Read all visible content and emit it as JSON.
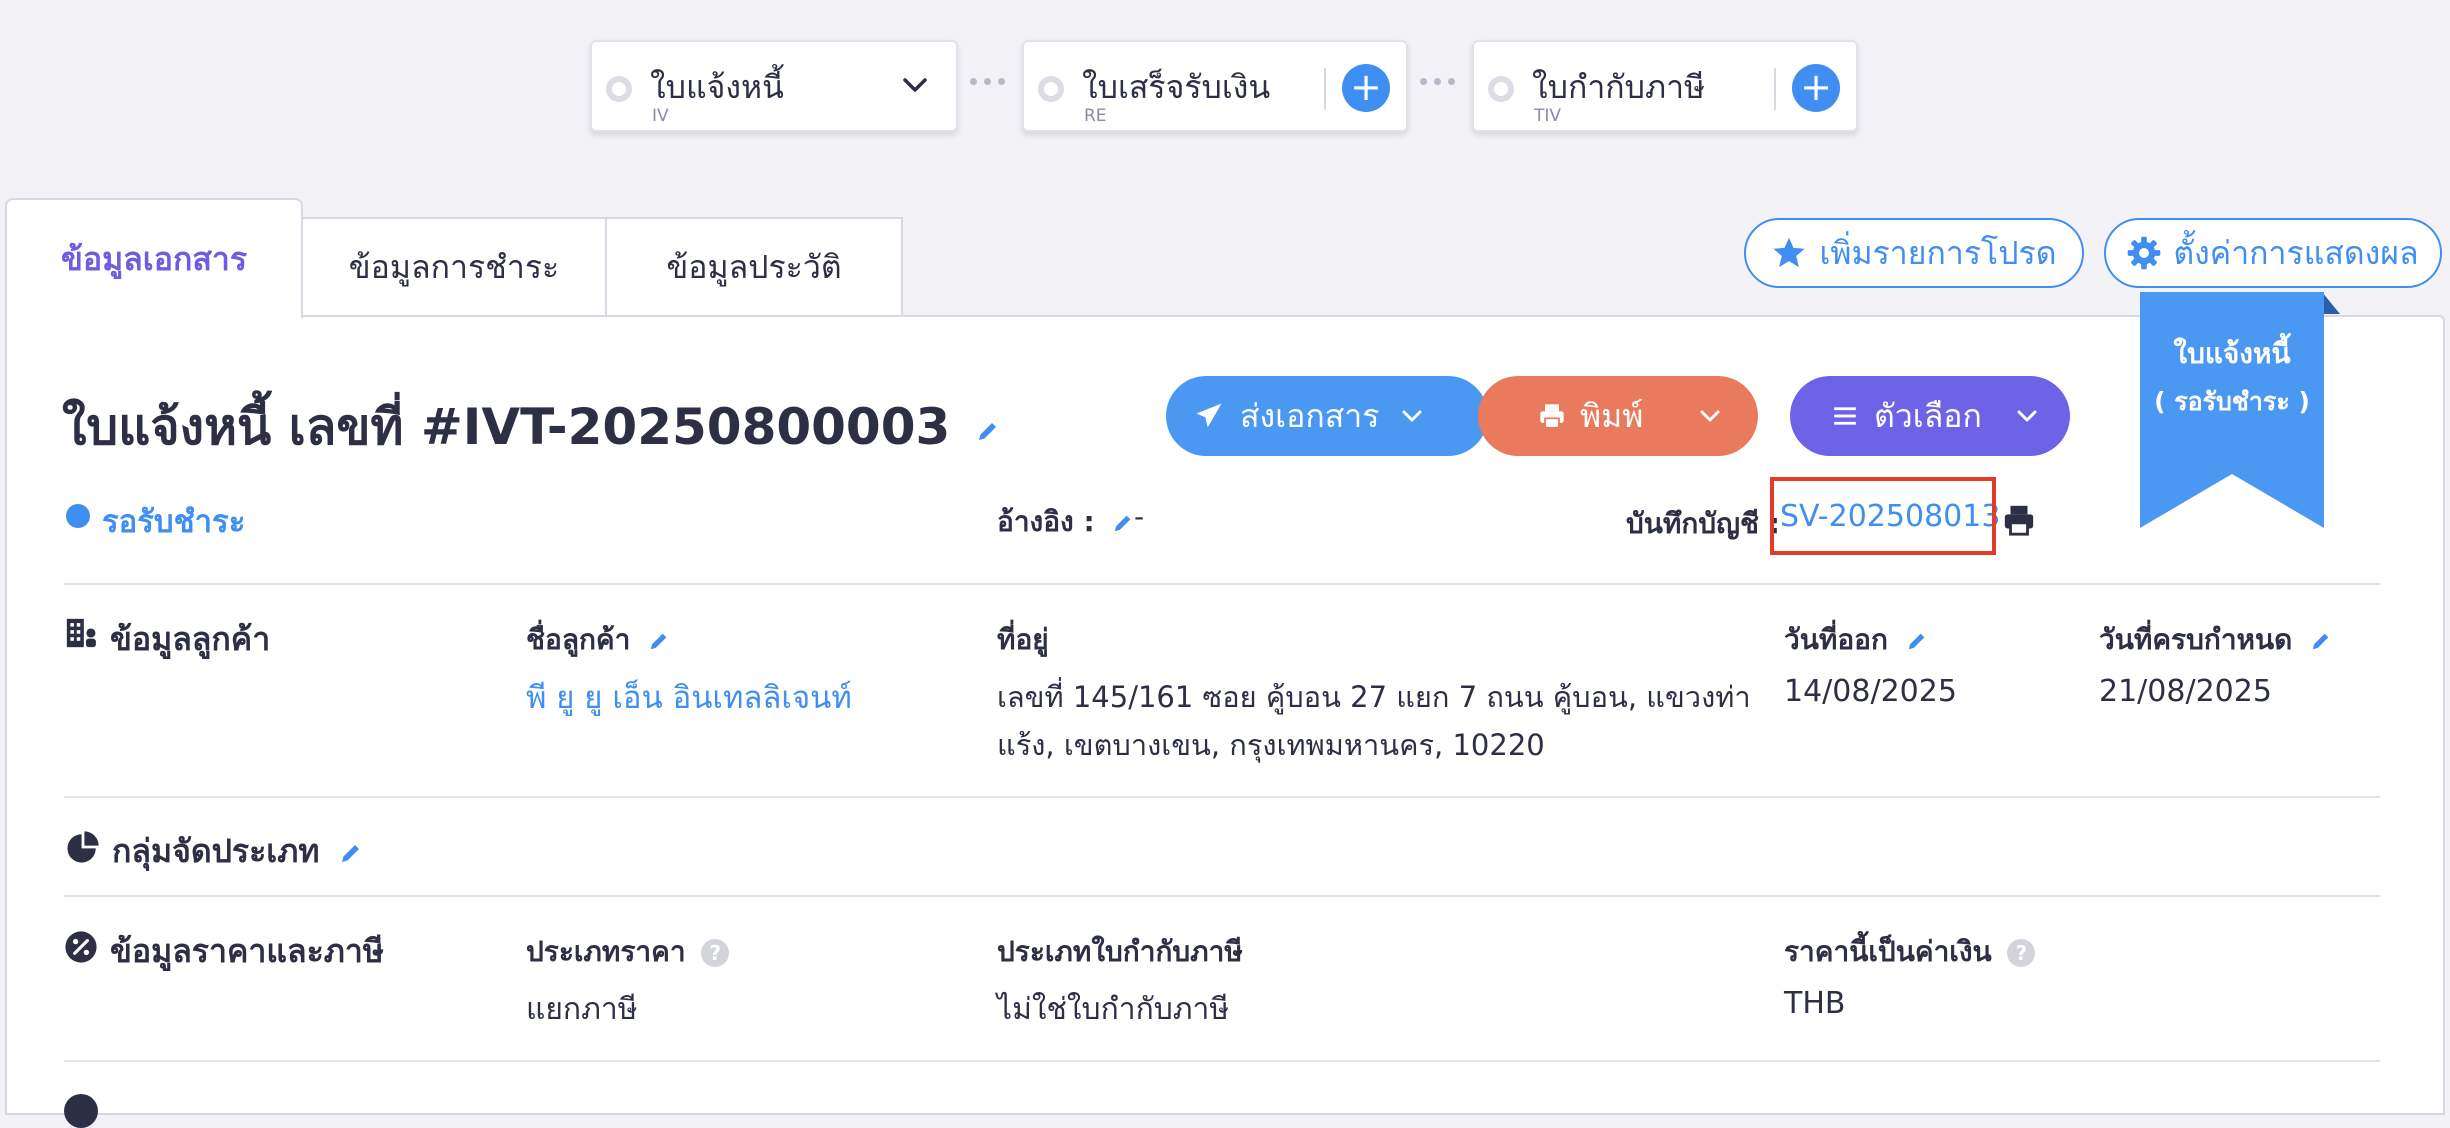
{
  "flow": [
    {
      "title": "ใบแจ้งหนี้",
      "code": "IV"
    },
    {
      "title": "ใบเสร็จรับเงิน",
      "code": "RE"
    },
    {
      "title": "ใบกำกับภาษี",
      "code": "TIV"
    }
  ],
  "tabs": {
    "document": "ข้อมูลเอกสาร",
    "payment": "ข้อมูลการชำระ",
    "history": "ข้อมูลประวัติ"
  },
  "actions": {
    "favorite": "เพิ่มรายการโปรด",
    "display_settings": "ตั้งค่าการแสดงผล",
    "send": "ส่งเอกสาร",
    "print": "พิมพ์",
    "options": "ตัวเลือก"
  },
  "ribbon": {
    "line1": "ใบแจ้งหนี้",
    "line2": "( รอรับชำระ )"
  },
  "document": {
    "title": "ใบแจ้งหนี้ เลขที่ #IVT-20250800003",
    "status": "รอรับชำระ",
    "reference_label": "อ้างอิง :",
    "reference_value": "-",
    "ledger_label": "บันทึกบัญชี :",
    "ledger_value": "SV-202508013"
  },
  "customer": {
    "section_title": "ข้อมูลลูกค้า",
    "name_label": "ชื่อลูกค้า",
    "name_value": "พี ยู ยู เอ็น อินเทลลิเจนท์",
    "address_label": "ที่อยู่",
    "address_line1": "เลขที่ 145/161 ซอย คู้บอน 27 แยก 7 ถนน คู้บอน, แขวงท่า",
    "address_line2": "แร้ง, เขตบางเขน, กรุงเทพมหานคร, 10220",
    "issue_label": "วันที่ออก",
    "issue_value": "14/08/2025",
    "due_label": "วันที่ครบกำหนด",
    "due_value": "21/08/2025"
  },
  "category": {
    "section_title": "กลุ่มจัดประเภท"
  },
  "pricing": {
    "section_title": "ข้อมูลราคาและภาษี",
    "price_type_label": "ประเภทราคา",
    "price_type_value": "แยกภาษี",
    "tax_invoice_type_label": "ประเภทใบกำกับภาษี",
    "tax_invoice_type_value": "ไม่ใช่ใบกำกับภาษี",
    "currency_label": "ราคานี้เป็นค่าเงิน",
    "currency_value": "THB"
  },
  "colors": {
    "accent_blue": "#3f8ef2",
    "accent_orange": "#ea7a5e",
    "accent_purple": "#6c63e6",
    "highlight_red": "#e23b2a"
  }
}
